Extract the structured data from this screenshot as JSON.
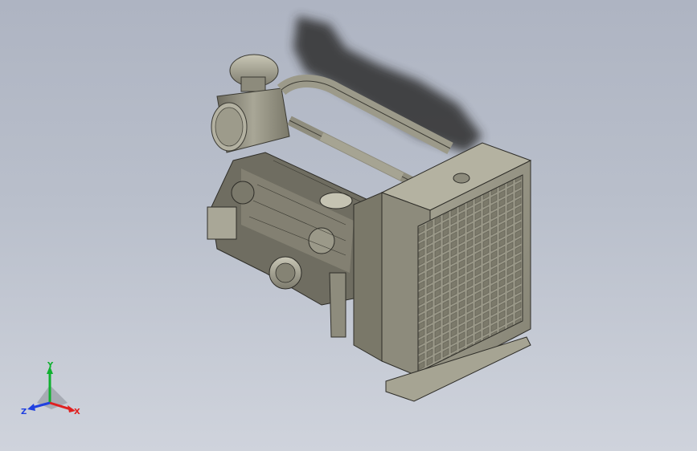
{
  "viewport": {
    "background_top": "#aeb4c2",
    "background_bottom": "#cfd3dc"
  },
  "model": {
    "description_icon": "engine-generator-icon",
    "body_color": "#8e8c7e",
    "shadow_color": "#3a3a3a"
  },
  "triad": {
    "x_label": "X",
    "y_label": "Y",
    "z_label": "Z",
    "x_color": "#e02020",
    "y_color": "#10b030",
    "z_color": "#2040e0"
  }
}
